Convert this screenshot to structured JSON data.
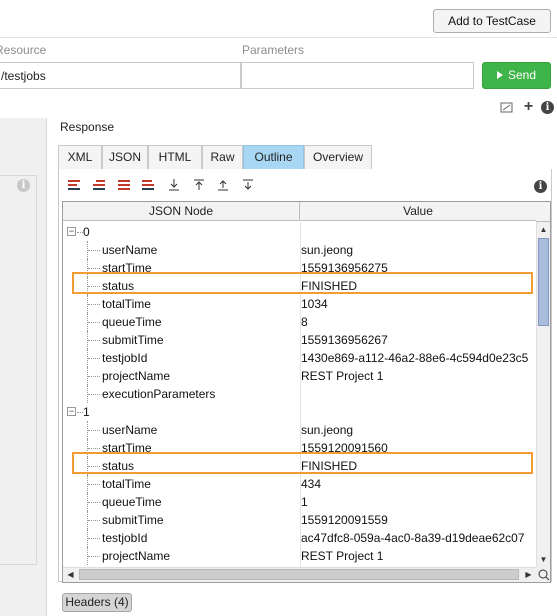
{
  "toolbar": {
    "add_to_testcase": "Add to TestCase"
  },
  "request": {
    "resource_label": "Resource",
    "resource_value": "/testjobs",
    "parameters_label": "Parameters",
    "parameters_value": "",
    "send_label": "Send"
  },
  "response": {
    "label": "Response",
    "tabs": [
      "XML",
      "JSON",
      "HTML",
      "Raw",
      "Outline",
      "Overview"
    ],
    "active_tab": "Outline",
    "columns": {
      "node": "JSON Node",
      "value": "Value"
    },
    "rows": [
      {
        "node": "0",
        "value": "",
        "level": 0,
        "expander": "−"
      },
      {
        "node": "userName",
        "value": "sun.jeong",
        "level": 1
      },
      {
        "node": "startTime",
        "value": "1559136956275",
        "level": 1
      },
      {
        "node": "status",
        "value": "FINISHED",
        "level": 1,
        "highlight": true
      },
      {
        "node": "totalTime",
        "value": "1034",
        "level": 1
      },
      {
        "node": "queueTime",
        "value": "8",
        "level": 1
      },
      {
        "node": "submitTime",
        "value": "1559136956267",
        "level": 1
      },
      {
        "node": "testjobId",
        "value": "1430e869-a112-46a2-88e6-4c594d0e23c5",
        "level": 1
      },
      {
        "node": "projectName",
        "value": "REST Project 1",
        "level": 1
      },
      {
        "node": "executionParameters",
        "value": "",
        "level": 1
      },
      {
        "node": "1",
        "value": "",
        "level": 0,
        "expander": "−"
      },
      {
        "node": "userName",
        "value": "sun.jeong",
        "level": 1
      },
      {
        "node": "startTime",
        "value": "1559120091560",
        "level": 1
      },
      {
        "node": "status",
        "value": "FINISHED",
        "level": 1,
        "highlight": true
      },
      {
        "node": "totalTime",
        "value": "434",
        "level": 1
      },
      {
        "node": "queueTime",
        "value": "1",
        "level": 1
      },
      {
        "node": "submitTime",
        "value": "1559120091559",
        "level": 1
      },
      {
        "node": "testjobId",
        "value": "ac47dfc8-059a-4ac0-8a39-d19deae62c07",
        "level": 1
      },
      {
        "node": "projectName",
        "value": "REST Project 1",
        "level": 1
      }
    ]
  },
  "footer": {
    "headers_button": "Headers (4)"
  },
  "colors": {
    "send": "#3fb549",
    "active_tab": "#a8d7f4",
    "highlight": "#f39c33",
    "scroll_thumb": "#a9bcdc"
  }
}
